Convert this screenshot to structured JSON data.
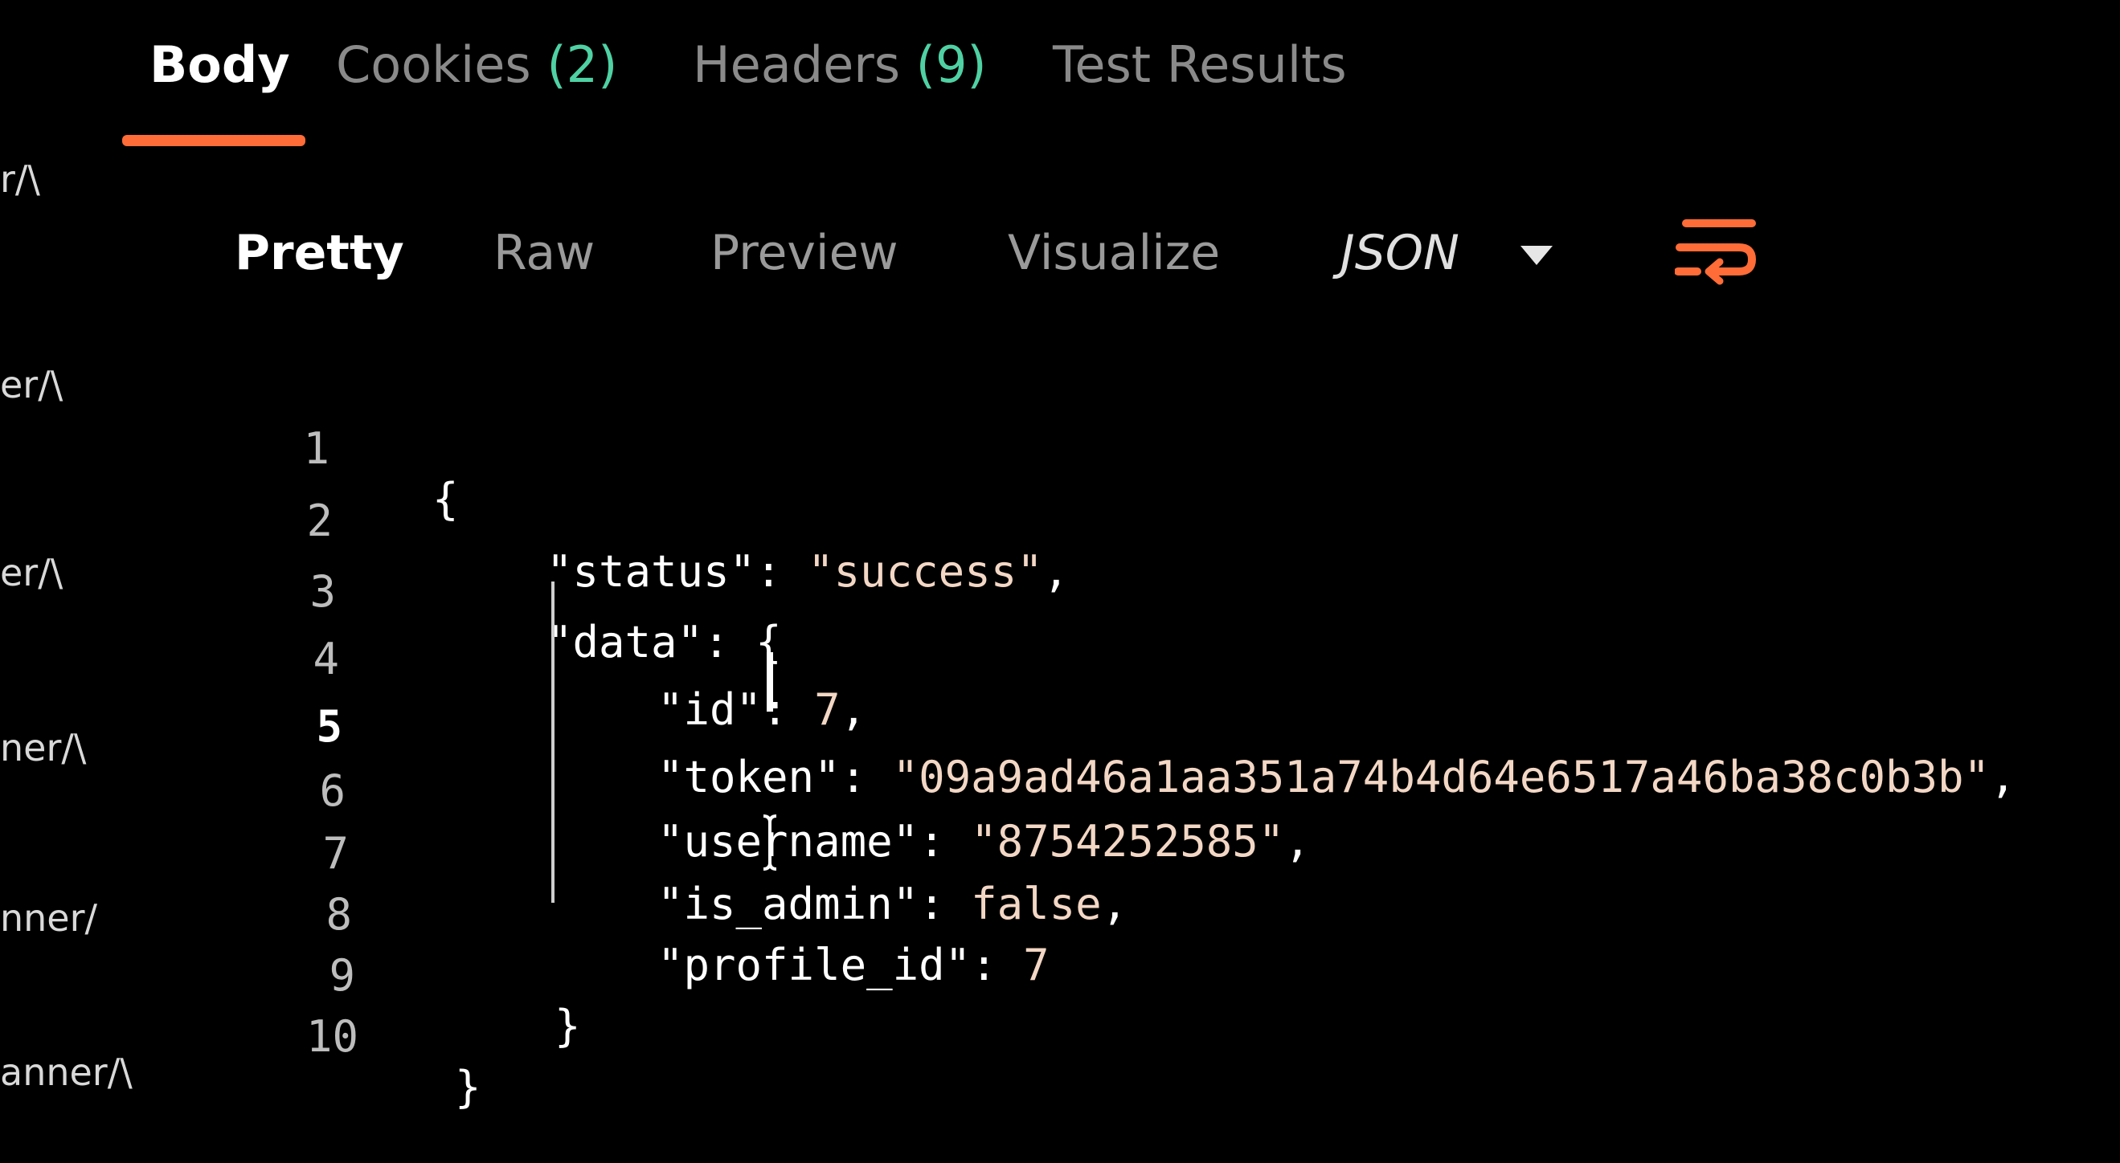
{
  "colors": {
    "accent": "#ff6c37",
    "count_green": "#4fd1a4",
    "string_value": "#f3d7c5",
    "background": "#000000"
  },
  "sidebar": {
    "items": [
      {
        "label": "r/\\"
      },
      {
        "label": "er/\\"
      },
      {
        "label": "er/\\"
      },
      {
        "label": "ner/\\"
      },
      {
        "label": "nner/"
      },
      {
        "label": "anner/\\"
      }
    ]
  },
  "tabs": [
    {
      "label": "Body",
      "count": "",
      "active": true
    },
    {
      "label": "Cookies",
      "count": "(2)",
      "active": false
    },
    {
      "label": "Headers",
      "count": "(9)",
      "active": false
    },
    {
      "label": "Test Results",
      "count": "",
      "active": false
    }
  ],
  "toolbar": {
    "modes": [
      {
        "label": "Pretty",
        "active": true
      },
      {
        "label": "Raw",
        "active": false
      },
      {
        "label": "Preview",
        "active": false
      },
      {
        "label": "Visualize",
        "active": false
      }
    ],
    "format": "JSON",
    "format_caret_icon": "chevron-down-icon",
    "wrap_icon": "wrap-lines-icon"
  },
  "code": {
    "current_line": 5,
    "line_numbers": [
      "1",
      "2",
      "3",
      "4",
      "5",
      "6",
      "7",
      "8",
      "9",
      "10"
    ],
    "lines": [
      {
        "key": "",
        "value": "{",
        "suffix": ""
      },
      {
        "key": "\"status\"",
        "value": "\"success\"",
        "suffix": ","
      },
      {
        "key": "\"data\"",
        "value": "{",
        "suffix": ""
      },
      {
        "key": "\"id\"",
        "value": "7",
        "suffix": ","
      },
      {
        "key": "\"token\"",
        "value": "\"09a9ad46a1aa351a74b4d64e6517a46ba38c0b3b\"",
        "suffix": ","
      },
      {
        "key": "\"username\"",
        "value": "\"8754252585\"",
        "suffix": ","
      },
      {
        "key": "\"is_admin\"",
        "value": "false",
        "suffix": ","
      },
      {
        "key": "\"profile_id\"",
        "value": "7",
        "suffix": ""
      },
      {
        "key": "",
        "value": "}",
        "suffix": ""
      },
      {
        "key": "",
        "value": "}",
        "suffix": ""
      }
    ]
  }
}
